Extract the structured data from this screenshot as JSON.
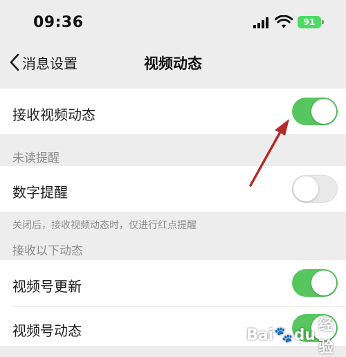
{
  "status_bar": {
    "time": "09:36",
    "battery": "91"
  },
  "nav": {
    "back_label": "消息设置",
    "title": "视频动态"
  },
  "settings": {
    "receive_video_updates": {
      "label": "接收视频动态",
      "enabled": true
    },
    "unread_section": "未读提醒",
    "number_reminder": {
      "label": "数字提醒",
      "enabled": false
    },
    "footnote": "关闭后，接收视频动态时，仅进行红点提醒",
    "receive_section": "接收以下动态",
    "channel_updates": {
      "label": "视频号更新",
      "enabled": true
    },
    "channel_activity": {
      "label": "视频号动态",
      "enabled": true
    }
  },
  "watermark": {
    "brand": "Bai",
    "brand2": "du",
    "cn": "经验"
  },
  "colors": {
    "toggle_on": "#57c65e",
    "toggle_off": "#e9e9ea",
    "arrow": "#b52a2a",
    "background": "#ededed"
  }
}
